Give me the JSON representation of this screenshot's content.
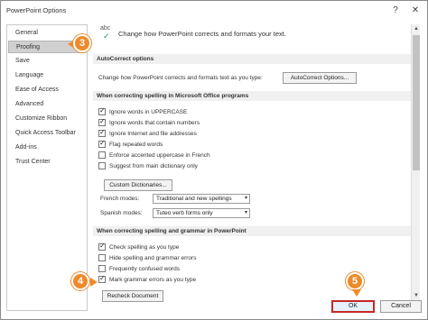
{
  "window": {
    "title": "PowerPoint Options",
    "help": "?",
    "close": "✕"
  },
  "sidebar": {
    "items": [
      {
        "label": "General"
      },
      {
        "label": "Proofing"
      },
      {
        "label": "Save"
      },
      {
        "label": "Language"
      },
      {
        "label": "Ease of Access"
      },
      {
        "label": "Advanced"
      },
      {
        "label": "Customize Ribbon"
      },
      {
        "label": "Quick Access Toolbar"
      },
      {
        "label": "Add-ins"
      },
      {
        "label": "Trust Center"
      }
    ],
    "selected": "Proofing"
  },
  "callouts": {
    "c3": "3",
    "c4": "4",
    "c5": "5"
  },
  "header": {
    "icon_text": "abc",
    "text": "Change how PowerPoint corrects and formats your text."
  },
  "autocorrect": {
    "section": "AutoCorrect options",
    "label": "Change how PowerPoint corrects and formats text as you type:",
    "button": "AutoCorrect Options..."
  },
  "office_spelling": {
    "section": "When correcting spelling in Microsoft Office programs",
    "options": [
      {
        "label": "Ignore words in UPPERCASE",
        "checked": true
      },
      {
        "label": "Ignore words that contain numbers",
        "checked": true
      },
      {
        "label": "Ignore Internet and file addresses",
        "checked": true
      },
      {
        "label": "Flag repeated words",
        "checked": true
      },
      {
        "label": "Enforce accented uppercase in French",
        "checked": false
      },
      {
        "label": "Suggest from main dictionary only",
        "checked": false
      }
    ],
    "custom_dict_button": "Custom Dictionaries...",
    "french_label": "French modes:",
    "french_value": "Traditional and new spellings",
    "spanish_label": "Spanish modes:",
    "spanish_value": "Tuteo verb forms only"
  },
  "ppt_spelling": {
    "section": "When correcting spelling and grammar in PowerPoint",
    "options": [
      {
        "label": "Check spelling as you type",
        "checked": true
      },
      {
        "label": "Hide spelling and grammar errors",
        "checked": false
      },
      {
        "label": "Frequently confused words",
        "checked": false
      },
      {
        "label": "Mark grammar errors as you type",
        "checked": true
      }
    ],
    "recheck_button": "Recheck Document"
  },
  "footer": {
    "ok": "OK",
    "cancel": "Cancel"
  }
}
